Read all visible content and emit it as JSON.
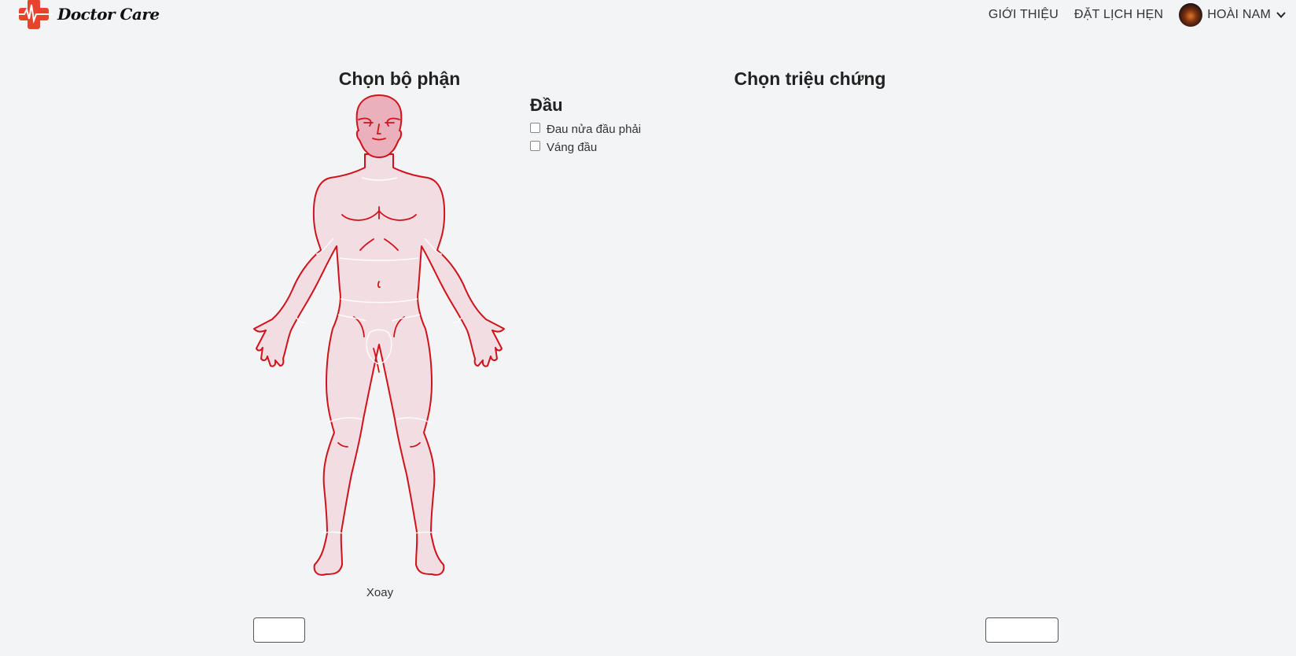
{
  "navbar": {
    "brand_name": "Doctor Care",
    "links": [
      "GIỚI THIỆU",
      "ĐẶT LỊCH HẸN"
    ],
    "user_name": "HOÀI NAM"
  },
  "body_selector": {
    "title": "Chọn bộ phận",
    "rotate_label": "Xoay"
  },
  "symptoms": {
    "title": "Chọn triệu chứng",
    "group": "Đầu",
    "items": [
      "Đau nửa đầu phải",
      "Váng đầu"
    ]
  },
  "colors": {
    "accent": "#d0121b",
    "body_fill": "#f2dde2",
    "head_highlight": "#eab0bc",
    "logo": "#e8432f"
  },
  "icons": {
    "logo": "medical-cross-heartbeat-icon",
    "dropdown": "chevron-down-icon"
  }
}
